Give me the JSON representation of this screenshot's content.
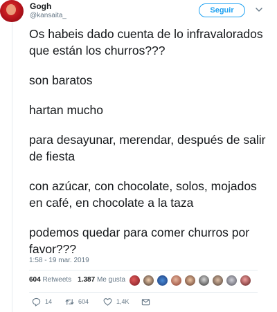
{
  "user": {
    "display_name": "Gogh",
    "handle": "@kansaita_"
  },
  "follow_button": "Seguir",
  "tweet": {
    "paragraphs": [
      "Os habeis dado cuenta de lo infravalorados que están los churros???",
      "son baratos",
      "hartan mucho",
      "para desayunar, merendar, después de salir de fiesta",
      "con azúcar, con chocolate, solos, mojados en café, en  chocolate a la taza",
      "podemos quedar para comer churros por favor???"
    ],
    "timestamp": "1:58 - 19 mar. 2019"
  },
  "stats": {
    "retweets_count": "604",
    "retweets_label": "Retweets",
    "likes_count": "1.387",
    "likes_label": "Me gusta"
  },
  "actions": {
    "reply_count": "14",
    "retweet_count": "604",
    "like_count": "1,4K"
  },
  "colors": {
    "accent": "#1da1f2",
    "muted": "#657786",
    "text": "#14171a",
    "divider": "#e6ecf0"
  },
  "icons": [
    "chevron-down-icon",
    "reply-icon",
    "retweet-icon",
    "heart-icon",
    "message-icon"
  ]
}
